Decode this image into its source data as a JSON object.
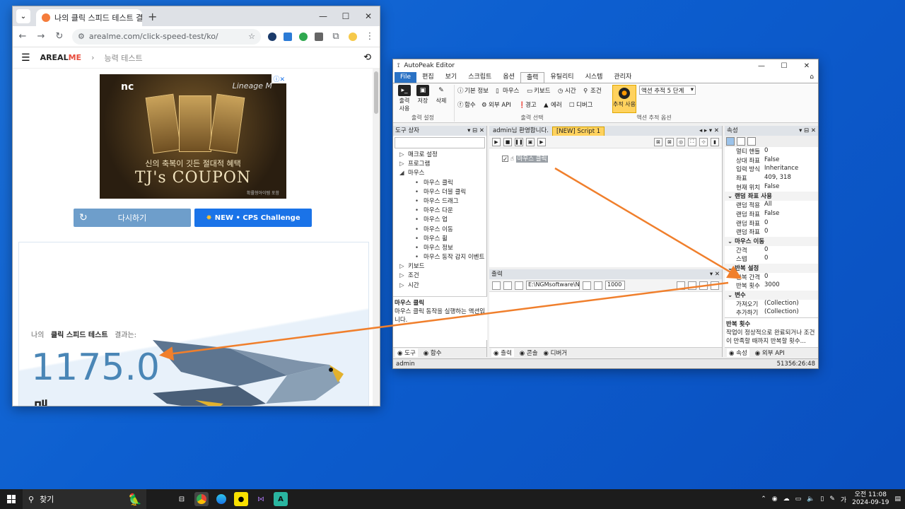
{
  "chrome": {
    "tab_title": "나의 클릭 스피드 테스트 결과는",
    "url": "arealme.com/click-speed-test/ko/",
    "site_logo_a": "AREAL",
    "site_logo_b": "ME",
    "breadcrumb": "능력 테스트",
    "ad": {
      "brand": "nc",
      "game": "Lineage M",
      "subtitle": "신의 축복이 깃든 절대적 혜택",
      "title": "TJ's COUPON",
      "fine_print": "확률형아이템 포함"
    },
    "retry_label": "다시하기",
    "cps_label": "NEW • CPS Challenge",
    "result_prefix": "나의",
    "result_test": "클릭 스피드 테스트",
    "result_suffix": "결과는:",
    "result_value": "1175.0",
    "result_unit": "매"
  },
  "autopeak": {
    "title": "AutoPeak Editor",
    "menu": [
      "File",
      "편집",
      "보기",
      "스크립트",
      "옵션",
      "출력",
      "유틸리티",
      "시스템",
      "관리자"
    ],
    "ribbon": {
      "output_btn": "출력\n사용",
      "save_btn": "저장",
      "delete_btn": "삭제",
      "group1_label": "출력 설정",
      "items": [
        "기본 정보",
        "마우스",
        "키보드",
        "시간",
        "조건",
        "함수",
        "외부 API",
        "경고",
        "에러",
        "디버그"
      ],
      "group2_label": "출력 선택",
      "trace_btn": "추적 사용",
      "trace_combo": "액션 추적 5 단계",
      "group3_label": "액션 추적 옵션"
    },
    "toolbox": {
      "header": "도구 상자",
      "items": [
        {
          "level": 1,
          "label": "매크로 설정"
        },
        {
          "level": 1,
          "label": "프로그램"
        },
        {
          "level": 1,
          "label": "마우스"
        },
        {
          "level": 2,
          "label": "마우스 클릭"
        },
        {
          "level": 2,
          "label": "마우스 더블 클릭"
        },
        {
          "level": 2,
          "label": "마우스 드래그"
        },
        {
          "level": 2,
          "label": "마우스 다운"
        },
        {
          "level": 2,
          "label": "마우스 업"
        },
        {
          "level": 2,
          "label": "마우스 이동"
        },
        {
          "level": 2,
          "label": "마우스 휠"
        },
        {
          "level": 2,
          "label": "마우스 정보"
        },
        {
          "level": 2,
          "label": "마우스 동작 감지 이벤트"
        },
        {
          "level": 1,
          "label": "키보드"
        },
        {
          "level": 1,
          "label": "조건"
        },
        {
          "level": 1,
          "label": "시간"
        }
      ],
      "desc_title": "마우스 클릭",
      "desc_text": "마우스 클릭 동작을 실행하는 액션입니다.",
      "tab_tools": "도구",
      "tab_functions": "함수"
    },
    "editor": {
      "tab1": "admin님 환영합니다.",
      "tab2": "[NEW] Script 1",
      "script_item": "마우스 클릭"
    },
    "output": {
      "header": "출력",
      "path": "E:\\NGMsoftware\\NG",
      "count": "1000",
      "tab_output": "출력",
      "tab_console": "콘솔",
      "tab_debugger": "디버거"
    },
    "props": {
      "header": "속성",
      "rows": [
        {
          "type": "row",
          "k": "멀티 핸들",
          "v": "0"
        },
        {
          "type": "row",
          "k": "상대 좌표",
          "v": "False"
        },
        {
          "type": "row",
          "k": "입력 방식",
          "v": "Inheritance"
        },
        {
          "type": "row",
          "k": "좌표",
          "v": "409, 318"
        },
        {
          "type": "row",
          "k": "현재 위치",
          "v": "False"
        },
        {
          "type": "cat",
          "k": "랜덤 좌표 사용"
        },
        {
          "type": "row",
          "k": "랜덤 적용",
          "v": "All"
        },
        {
          "type": "row",
          "k": "랜덤 좌표",
          "v": "False"
        },
        {
          "type": "row",
          "k": "랜덤 좌표",
          "v": "0"
        },
        {
          "type": "row",
          "k": "랜덤 좌표",
          "v": "0"
        },
        {
          "type": "cat",
          "k": "마우스 이동"
        },
        {
          "type": "row",
          "k": "간격",
          "v": "0"
        },
        {
          "type": "row",
          "k": "스텝",
          "v": "0"
        },
        {
          "type": "cat",
          "k": "반복 설정"
        },
        {
          "type": "row",
          "k": "반복 간격",
          "v": "0"
        },
        {
          "type": "row",
          "k": "반복 횟수",
          "v": "3000"
        },
        {
          "type": "cat",
          "k": "변수"
        },
        {
          "type": "row",
          "k": "가져오기",
          "v": "(Collection)"
        },
        {
          "type": "row",
          "k": "추가하기",
          "v": "(Collection)"
        }
      ],
      "desc_title": "반복 횟수",
      "desc_text": "작업이 정상적으로 완료되거나 조건이 만족할 때까지 반복할 횟수...",
      "tab_props": "속성",
      "tab_api": "외부 API"
    },
    "status_user": "admin",
    "status_right": "51356:26:48"
  },
  "taskbar": {
    "search": "찾기",
    "time_label": "오전 11:08",
    "date": "2024-09-19"
  },
  "colors": {
    "desktop": "#0d5fd0",
    "accent": "#1a73e8",
    "arrow": "#f07f2c",
    "result": "#4a86b6"
  }
}
